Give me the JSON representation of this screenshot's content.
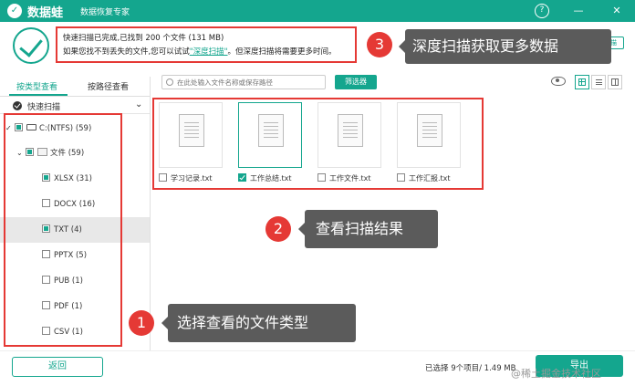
{
  "titlebar": {
    "logo_glyph": "✓",
    "app_name": "数据蛙",
    "subtitle": "数据恢复专家",
    "help_glyph": "?",
    "minimize_glyph": "—",
    "close_glyph": "✕"
  },
  "header": {
    "line1": "快速扫描已完成,已找到 200 个文件 (131 MB)",
    "line2_before": "如果您找不到丢失的文件,您可以试试",
    "line2_link": "\"深度扫描\"",
    "line2_after": "。但深度扫描将需要更多时间。",
    "deep_scan_button_stub": "扫描"
  },
  "annotations": [
    {
      "number": "3",
      "text": "深度扫描获取更多数据"
    },
    {
      "number": "2",
      "text": "查看扫描结果"
    },
    {
      "number": "1",
      "text": "选择查看的文件类型"
    }
  ],
  "left_panel": {
    "tabs": [
      {
        "label": "按类型查看",
        "active": true
      },
      {
        "label": "按路径查看",
        "active": false
      }
    ],
    "quick_scan_label": "快速扫描",
    "tree": [
      {
        "label": "C:(NTFS) (59)"
      },
      {
        "label": "文件 (59)"
      },
      {
        "label": "XLSX (31)"
      },
      {
        "label": "DOCX (16)"
      },
      {
        "label": "TXT (4)"
      },
      {
        "label": "PPTX (5)"
      },
      {
        "label": "PUB (1)"
      },
      {
        "label": "PDF (1)"
      },
      {
        "label": "CSV (1)"
      }
    ]
  },
  "toolbar": {
    "search_placeholder": "在此处输入文件名称或保存路径",
    "filter_label": "筛选器"
  },
  "files": [
    {
      "name": "学习记录.txt",
      "checked": false
    },
    {
      "name": "工作总结.txt",
      "checked": true
    },
    {
      "name": "工作文件.txt",
      "checked": false
    },
    {
      "name": "工作汇报.txt",
      "checked": false
    }
  ],
  "footer": {
    "back_label": "返回",
    "selected_text": "已选择 9个项目/ 1.49 MB",
    "export_label": "导出",
    "watermark": "@稀土掘金技术社区"
  },
  "colors": {
    "brand": "#14a68e",
    "annotation_red": "#e53935",
    "callout_gray": "#5b5b5b"
  }
}
